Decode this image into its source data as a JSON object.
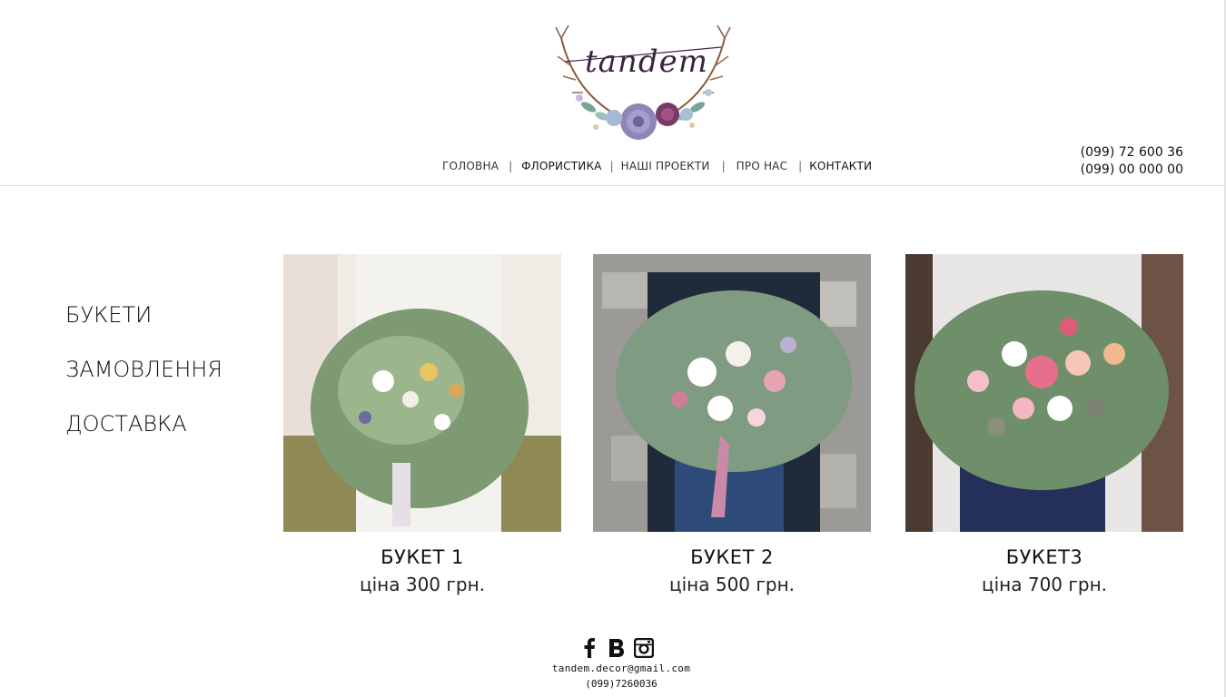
{
  "logo": {
    "text": "tandem"
  },
  "nav": {
    "items": [
      {
        "label": "ГОЛОВНА"
      },
      {
        "label": "ФЛОРИСТИКА"
      },
      {
        "label": "НАШІ ПРОЕКТИ"
      },
      {
        "label": "ПРО НАС"
      },
      {
        "label": "КОНТАКТИ"
      }
    ],
    "separator": "|"
  },
  "contact": {
    "phones": [
      "(099) 72 600 36",
      "(099) 00 000 00"
    ]
  },
  "sidebar": {
    "items": [
      {
        "label": "БУКЕТИ"
      },
      {
        "label": "ЗАМОВЛЕННЯ"
      },
      {
        "label": "ДОСТАВКА"
      }
    ]
  },
  "products": [
    {
      "name": "БУКЕТ 1",
      "price": "ціна 300 грн."
    },
    {
      "name": "БУКЕТ 2",
      "price": "ціна 500 грн."
    },
    {
      "name": "БУКЕТ3",
      "price": "ціна 700 грн."
    }
  ],
  "footer": {
    "social": [
      "facebook-icon",
      "vk-icon",
      "instagram-icon"
    ],
    "email": "tandem.decor@gmail.com",
    "phone": "(099)7260036"
  },
  "colors": {
    "text": "#111111",
    "divider": "#dcdcdc",
    "background": "#ffffff"
  }
}
